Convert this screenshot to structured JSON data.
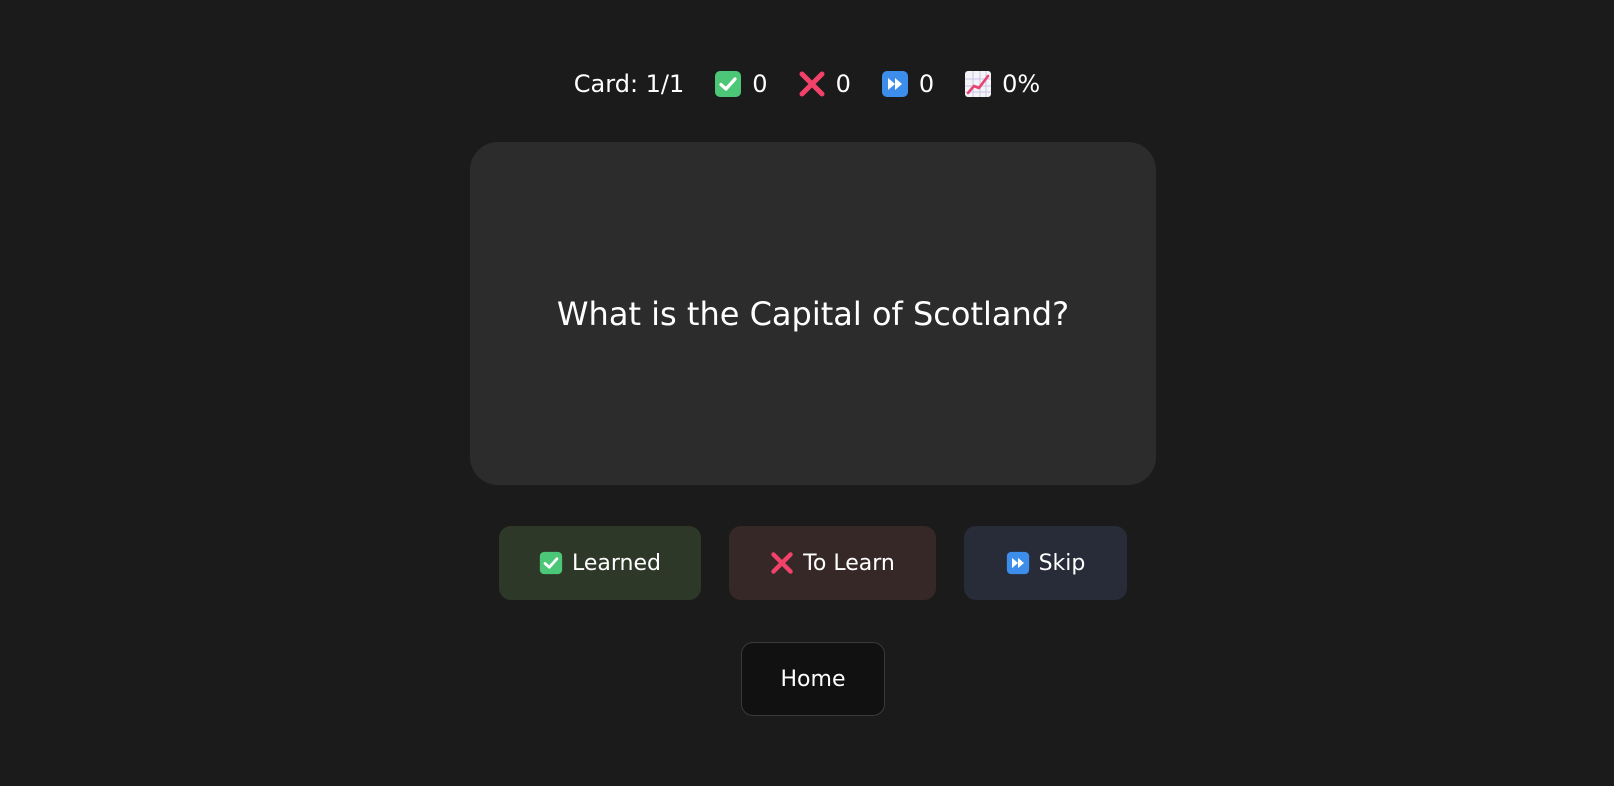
{
  "stats": {
    "card_label": "Card: 1/1",
    "learned_count": "0",
    "to_learn_count": "0",
    "skipped_count": "0",
    "progress": "0%"
  },
  "card": {
    "question": "What is the Capital of Scotland?"
  },
  "actions": {
    "learned_label": "Learned",
    "to_learn_label": "To Learn",
    "skip_label": "Skip",
    "home_label": "Home"
  },
  "icons": {
    "learned": "check-mark-button-icon",
    "to_learn": "cross-mark-icon",
    "skip": "fast-forward-icon",
    "progress": "chart-increasing-icon"
  },
  "colors": {
    "background": "#1b1b1b",
    "card": "#2c2c2c",
    "learned_button": "#2d3828",
    "to_learn_button": "#372828",
    "skip_button": "#282c38",
    "home_button": "#111111",
    "check_green": "#4cc777",
    "cross_red": "#f2426a",
    "skip_blue": "#3d8eea"
  }
}
